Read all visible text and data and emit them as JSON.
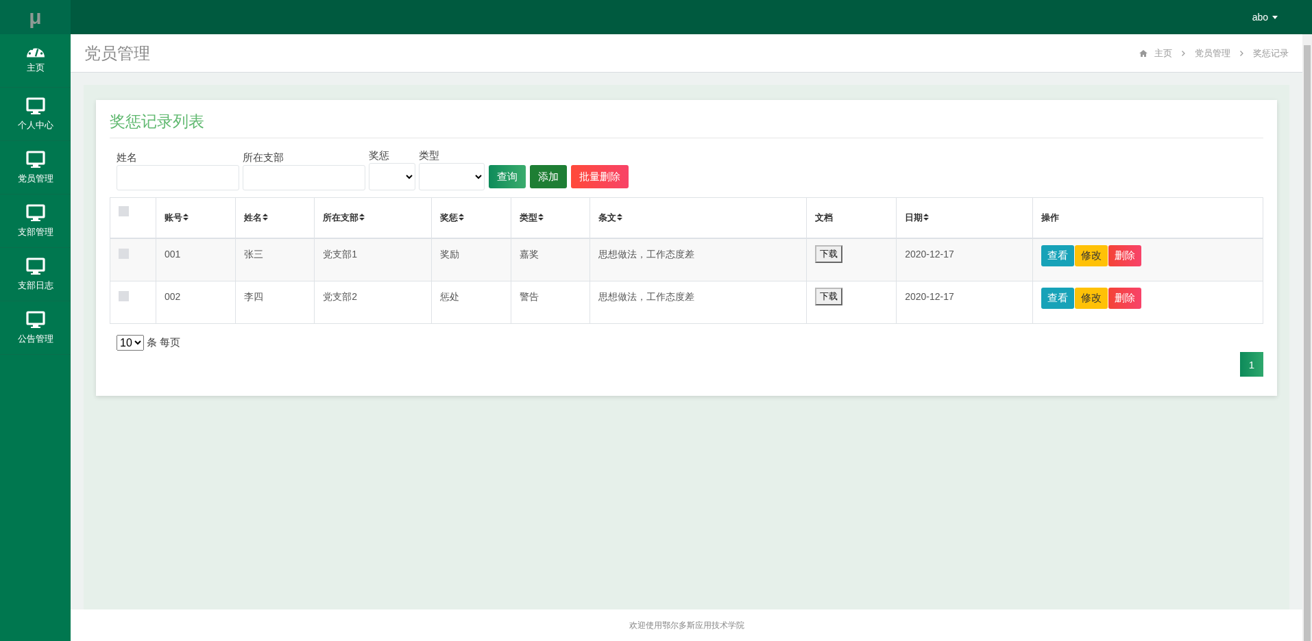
{
  "sidebar": {
    "logo": "μ",
    "items": [
      {
        "label": "主页",
        "kind": "dashboard",
        "selected": false
      },
      {
        "label": "个人中心",
        "kind": "monitor",
        "selected": false
      },
      {
        "label": "党员管理",
        "kind": "monitor",
        "selected": false
      },
      {
        "label": "支部管理",
        "kind": "monitor",
        "selected": false
      },
      {
        "label": "支部日志",
        "kind": "monitor",
        "selected": false
      },
      {
        "label": "公告管理",
        "kind": "monitor",
        "selected": false
      }
    ]
  },
  "topbar": {
    "user": "abo"
  },
  "page_header": {
    "title": "党员管理",
    "breadcrumb": [
      "主页",
      "党员管理",
      "奖惩记录"
    ]
  },
  "card": {
    "title": "奖惩记录列表",
    "filters": [
      {
        "label": "姓名",
        "kind": "text"
      },
      {
        "label": "所在支部",
        "kind": "text"
      },
      {
        "label": "奖惩",
        "kind": "select"
      },
      {
        "label": "类型",
        "kind": "select"
      }
    ],
    "buttons": [
      {
        "label": "查询",
        "kind": "search"
      },
      {
        "label": "添加",
        "kind": "add"
      },
      {
        "label": "批量删除",
        "kind": "delete"
      }
    ],
    "table": {
      "select_all_checked": false,
      "columns": [
        {
          "label": "账号",
          "sortable": true
        },
        {
          "label": "姓名",
          "sortable": true
        },
        {
          "label": "所在支部",
          "sortable": true
        },
        {
          "label": "奖惩",
          "sortable": true
        },
        {
          "label": "类型",
          "sortable": true
        },
        {
          "label": "条文",
          "sortable": true
        },
        {
          "label": "文档",
          "sortable": false
        },
        {
          "label": "日期",
          "sortable": true
        },
        {
          "label": "操作",
          "sortable": false
        }
      ],
      "rows": [
        {
          "checked": false,
          "cells": [
            "001",
            "张三",
            "党支部1",
            "奖励",
            "嘉奖",
            "思想做法，工作态度差"
          ],
          "download": "下载",
          "date": "2020-12-17",
          "actions": [
            {
              "label": "查看",
              "kind": "view"
            },
            {
              "label": "修改",
              "kind": "edit"
            },
            {
              "label": "删除",
              "kind": "delete"
            }
          ]
        },
        {
          "checked": false,
          "cells": [
            "002",
            "李四",
            "党支部2",
            "惩处",
            "警告",
            "思想做法，工作态度差"
          ],
          "download": "下载",
          "date": "2020-12-17",
          "actions": [
            {
              "label": "查看",
              "kind": "view"
            },
            {
              "label": "修改",
              "kind": "edit"
            },
            {
              "label": "删除",
              "kind": "delete"
            }
          ]
        }
      ]
    },
    "page_size": "10",
    "page_size_suffix": "条 每页",
    "pages": [
      {
        "label": "1",
        "selected": true
      }
    ]
  },
  "footer": "欢迎使用鄂尔多斯应用技术学院"
}
